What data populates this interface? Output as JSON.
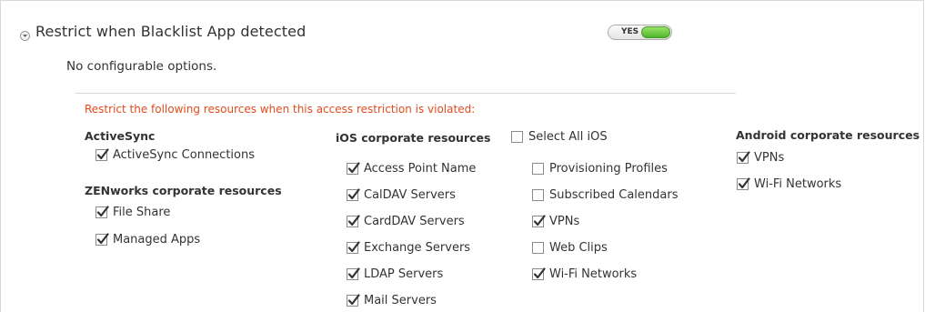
{
  "rule": {
    "title": "Restrict when Blacklist App detected",
    "enabled_label": "YES",
    "enabled": true,
    "no_options_text": "No configurable options."
  },
  "restrictions": {
    "heading": "Restrict the following resources when this access restriction is violated:",
    "activesync": {
      "title": "ActiveSync",
      "items": [
        {
          "label": "ActiveSync Connections",
          "checked": true
        }
      ]
    },
    "zenworks": {
      "title": "ZENworks corporate resources",
      "items": [
        {
          "label": "File Share",
          "checked": true
        },
        {
          "label": "Managed Apps",
          "checked": true
        }
      ]
    },
    "ios": {
      "title": "iOS corporate resources",
      "select_all_label": "Select All iOS",
      "select_all_checked": false,
      "items_col1": [
        {
          "label": "Access Point Name",
          "checked": true
        },
        {
          "label": "CalDAV Servers",
          "checked": true
        },
        {
          "label": "CardDAV Servers",
          "checked": true
        },
        {
          "label": "Exchange Servers",
          "checked": true
        },
        {
          "label": "LDAP Servers",
          "checked": true
        },
        {
          "label": "Mail Servers",
          "checked": true
        }
      ],
      "items_col2": [
        {
          "label": "Provisioning Profiles",
          "checked": false
        },
        {
          "label": "Subscribed Calendars",
          "checked": false
        },
        {
          "label": "VPNs",
          "checked": true
        },
        {
          "label": "Web Clips",
          "checked": false
        },
        {
          "label": "Wi-Fi Networks",
          "checked": true
        }
      ]
    },
    "android": {
      "title": "Android corporate resources",
      "items": [
        {
          "label": "VPNs",
          "checked": true
        },
        {
          "label": "Wi-Fi Networks",
          "checked": true
        }
      ]
    }
  },
  "colors": {
    "warning": "#e24b1c",
    "toggle_on": "#5cc030",
    "checkmark": "#333333"
  }
}
